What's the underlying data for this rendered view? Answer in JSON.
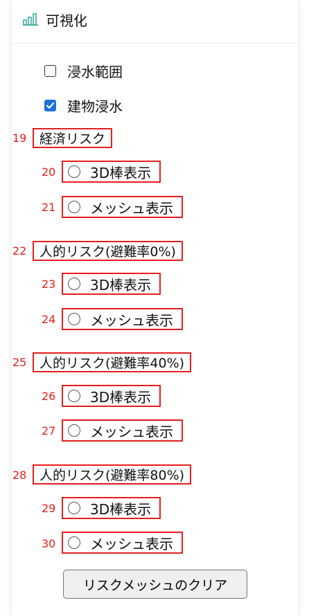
{
  "header": {
    "title": "可視化",
    "icon": "bar-chart-icon"
  },
  "layers": [
    {
      "label": "浸水範囲",
      "checked": false
    },
    {
      "label": "建物浸水",
      "checked": true
    }
  ],
  "sections": [
    {
      "num": "19",
      "title": "経済リスク",
      "options": [
        {
          "num": "20",
          "label": "3D棒表示"
        },
        {
          "num": "21",
          "label": "メッシュ表示"
        }
      ]
    },
    {
      "num": "22",
      "title": "人的リスク(避難率0%)",
      "options": [
        {
          "num": "23",
          "label": "3D棒表示"
        },
        {
          "num": "24",
          "label": "メッシュ表示"
        }
      ]
    },
    {
      "num": "25",
      "title": "人的リスク(避難率40%)",
      "options": [
        {
          "num": "26",
          "label": "3D棒表示"
        },
        {
          "num": "27",
          "label": "メッシュ表示"
        }
      ]
    },
    {
      "num": "28",
      "title": "人的リスク(避難率80%)",
      "options": [
        {
          "num": "29",
          "label": "3D棒表示"
        },
        {
          "num": "30",
          "label": "メッシュ表示"
        }
      ]
    }
  ],
  "clear_button": "リスクメッシュのクリア",
  "colors": {
    "accent": "#1d72d8",
    "annotation": "#e61d1d",
    "icon": "#3aa99f"
  }
}
